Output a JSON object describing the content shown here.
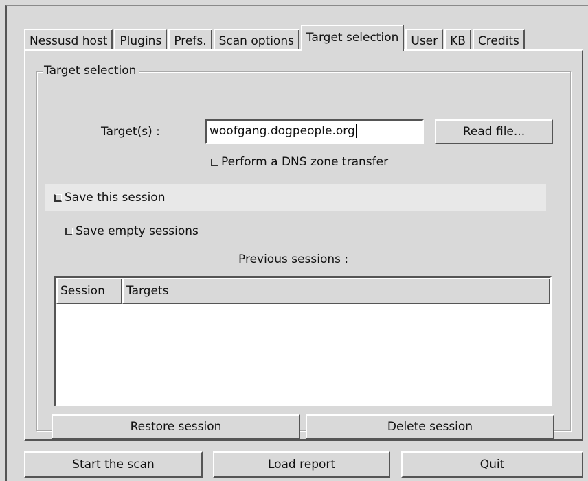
{
  "tabs": [
    "Nessusd host",
    "Plugins",
    "Prefs.",
    "Scan options",
    "Target selection",
    "User",
    "KB",
    "Credits"
  ],
  "active_tab": "Target selection",
  "frame_label": "Target selection",
  "target": {
    "label": "Target(s) :",
    "value": "woofgang.dogpeople.org",
    "read_file_label": "Read file..."
  },
  "checkboxes": {
    "dns_zone_transfer": "Perform a DNS zone transfer",
    "save_session": "Save this session",
    "save_empty": "Save empty sessions"
  },
  "previous_sessions_label": "Previous sessions :",
  "sessions_table": {
    "columns": [
      "Session",
      "Targets"
    ],
    "rows": []
  },
  "session_buttons": {
    "restore": "Restore session",
    "delete": "Delete session"
  },
  "bottom_buttons": {
    "start": "Start the scan",
    "load": "Load report",
    "quit": "Quit"
  }
}
